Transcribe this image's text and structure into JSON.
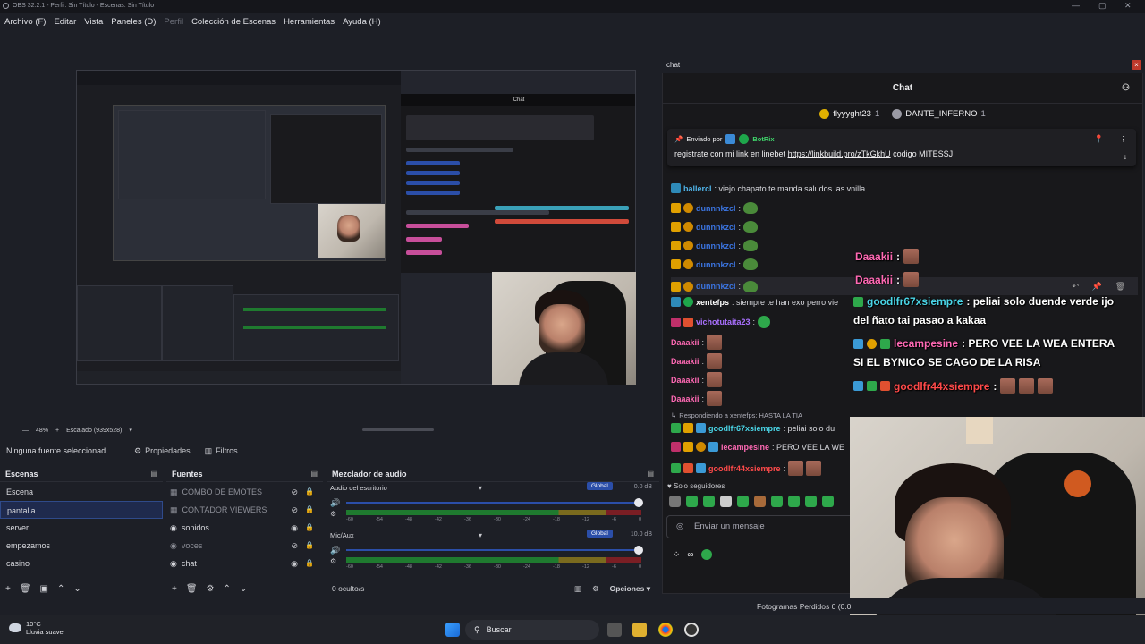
{
  "titlebar": {
    "text": "OBS 32.2.1 - Perfil: Sin Título - Escenas: Sin Título"
  },
  "menu": {
    "items": [
      "Archivo (F)",
      "Editar",
      "Vista",
      "Paneles (D)",
      "Perfil",
      "Colección de Escenas",
      "Herramientas",
      "Ayuda (H)"
    ]
  },
  "preview": {
    "zoom": "48%",
    "scale": "Escalado (939x528)"
  },
  "source_toolbar": {
    "no_source": "Ninguna fuente seleccionad",
    "properties": "Propiedades",
    "filters": "Filtros"
  },
  "scenes": {
    "title": "Escenas",
    "items": [
      "Escena",
      "pantalla",
      "server",
      "empezamos",
      "casino"
    ],
    "selected": "pantalla"
  },
  "sources": {
    "title": "Fuentes",
    "items": [
      "COMBO DE EMOTES",
      "CONTADOR VIEWERS",
      "sonidos",
      "voces",
      "chat"
    ]
  },
  "mixer": {
    "title": "Mezclador de audio",
    "tracks": [
      {
        "name": "Audio del escritorio",
        "global": "Global",
        "db": "0.0 dB"
      },
      {
        "name": "Mic/Aux",
        "global": "Global",
        "db": "10.0 dB"
      }
    ],
    "ticks": [
      "-60",
      "-54",
      "-48",
      "-42",
      "-36",
      "-30",
      "-24",
      "-18",
      "-12",
      "-6",
      "0"
    ],
    "hidden": "0 oculto/s",
    "options": "Opciones"
  },
  "status": {
    "dropped": "Fotogramas Perdidos 0 (0.0"
  },
  "taskbar": {
    "temp": "10°C",
    "weather": "Lluvia suave",
    "search": "Buscar"
  },
  "chat": {
    "dock_title": "chat",
    "header": "Chat",
    "hype_user_1": "flyyyght23",
    "hype_rank_1": "1",
    "hype_user_2": "DANTE_INFERNO",
    "hype_rank_2": "1",
    "pinned_by_label": "Enviado por",
    "pinned_by_user": "BotRix",
    "pinned_msg": "registrate con mi link en linebet",
    "pinned_link": "https://linkbuild.pro/zTkGkhU",
    "pinned_code": "codigo MITESSJ",
    "messages": [
      {
        "user": "ballercl",
        "color": "#4fb3e8",
        "text": ": viejo chapato te manda saludos las vnilla"
      },
      {
        "user": "dunnnkzcl",
        "color": "#3b74e0",
        "text": ":"
      },
      {
        "user": "dunnnkzcl",
        "color": "#3b74e0",
        "text": ":"
      },
      {
        "user": "dunnnkzcl",
        "color": "#3b74e0",
        "text": ":"
      },
      {
        "user": "dunnnkzcl",
        "color": "#3b74e0",
        "text": ":"
      },
      {
        "user": "dunnnkzcl",
        "color": "#3b74e0",
        "text": ":"
      },
      {
        "user": "xentefps",
        "color": "#ffffff",
        "text": ": siempre te han exo perro vie"
      },
      {
        "user": "vichotutaita23",
        "color": "#a970ff",
        "text": ":"
      },
      {
        "user": "Daaakii",
        "color": "#ff69b4",
        "text": ":"
      },
      {
        "user": "Daaakii",
        "color": "#ff69b4",
        "text": ":"
      },
      {
        "user": "Daaakii",
        "color": "#ff69b4",
        "text": ":"
      },
      {
        "user": "Daaakii",
        "color": "#ff69b4",
        "text": ":"
      }
    ],
    "reply_to": "Respondiendo a xentefps: HASTA LA TIA",
    "msg_good1_user": "goodlfr67xsiempre",
    "msg_good1_text": ": peliai solo du",
    "msg_lecam_user": "lecampesine",
    "msg_lecam_text": ": PERO VEE LA WE",
    "msg_good2_user": "goodlfr44xsiempre",
    "msg_good2_text": ":",
    "followers_only": "Solo seguidores",
    "input_placeholder": "Enviar un mensaje"
  },
  "overlay": {
    "d1_user": "Daaakii",
    "d2_user": "Daaakii",
    "good1_user": "goodlfr67xsiempre",
    "good1_text": ": peliai solo duende verde ijo",
    "good1_text2": "del ñato tai pasao a kakaa",
    "lecam_user": "lecampesine",
    "lecam_text": ": PERO VEE LA WEA ENTERA",
    "lecam_text2": "SI EL BYNICO SE CAGO DE LA RISA",
    "good2_user": "goodlfr44xsiempre",
    "good2_text": ":"
  },
  "colors": {
    "accent": "#2b4ea8",
    "twitch_purple": "#a970ff",
    "pink_user": "#ff69b4",
    "cyan_user": "#4ad6e8",
    "red_user": "#ff4a4a"
  }
}
